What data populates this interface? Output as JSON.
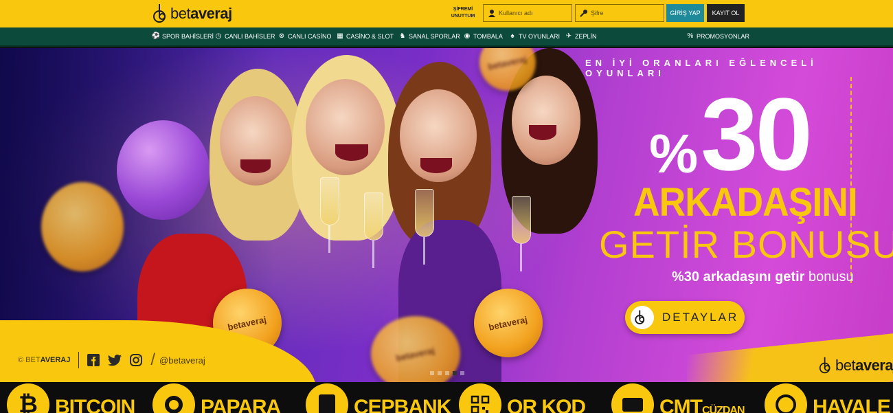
{
  "header": {
    "logo_prefix": "bet",
    "logo_suffix": "averaj",
    "forgot_line1": "ŞİFREMİ",
    "forgot_line2": "UNUTTUM",
    "username_placeholder": "Kullanıcı adı",
    "password_placeholder": "Şifre",
    "login_label": "GİRİŞ YAP",
    "register_label": "KAYIT OL"
  },
  "nav": {
    "items": [
      {
        "label": "SPOR BAHİSLERİ",
        "icon": "soccer-ball-icon"
      },
      {
        "label": "CANLI BAHİSLER",
        "icon": "live-clock-icon"
      },
      {
        "label": "CANLI CASİNO",
        "icon": "casino-chip-icon"
      },
      {
        "label": "CASİNO & SLOT",
        "icon": "slot-machine-icon"
      },
      {
        "label": "SANAL SPORLAR",
        "icon": "virtual-horse-icon"
      },
      {
        "label": "TOMBALA",
        "icon": "lottery-ball-icon"
      },
      {
        "label": "TV OYUNLARI",
        "icon": "spade-icon"
      },
      {
        "label": "ZEPLİN",
        "icon": "airplane-icon"
      },
      {
        "label": "PROMOSYONLAR",
        "icon": "percent-badge-icon"
      }
    ]
  },
  "hero": {
    "tagline": "EN İYİ ORANLARI EĞLENCELİ OYUNLARI",
    "percent_sign": "%",
    "big_number": "30",
    "line1": "ARKADAŞINI",
    "line2": "GETİR BONUSU",
    "sub_bold": "%30 arkadaşını getir",
    "sub_light": " bonusu",
    "button_label": "DETAYLAR",
    "copyright_prefix": "© BET",
    "copyright_suffix": "AVERAJ",
    "social_handle": "@betaveraj",
    "coin_text": "betaveraj",
    "slide_count": 5,
    "active_slide": 4,
    "colors": {
      "brand_yellow": "#f9c80e",
      "nav_green": "#0c4a3b",
      "login_teal": "#1f8a9a"
    }
  },
  "payments": [
    {
      "label": "BITCOIN",
      "icon": "bitcoin-icon"
    },
    {
      "label": "PAPARA",
      "icon": "papara-icon"
    },
    {
      "label": "CEPBANK",
      "icon": "cepbank-icon"
    },
    {
      "label": "QR KOD",
      "icon": "qr-code-icon"
    },
    {
      "label": "CMT",
      "label_small": "CÜZDAN",
      "icon": "wallet-icon"
    },
    {
      "label": "HAVALE",
      "icon": "bank-transfer-icon"
    }
  ]
}
